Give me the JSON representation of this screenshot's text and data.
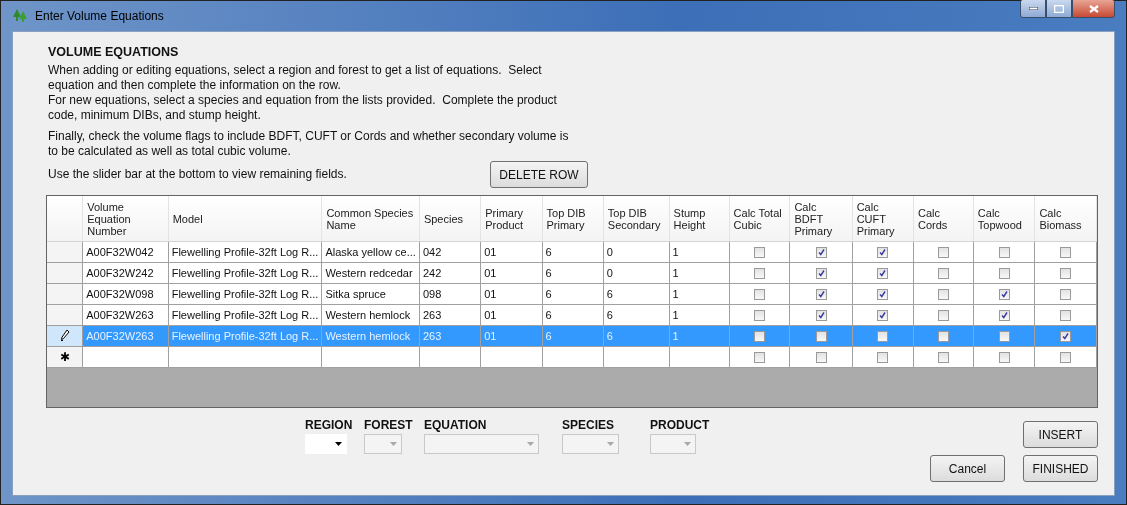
{
  "window": {
    "title": "Enter Volume Equations"
  },
  "intro": {
    "heading": "VOLUME EQUATIONS",
    "paragraphs": [
      "When adding or editing equations, select a region and forest to get a list of equations.  Select equation and then complete the information on the row.",
      "For new equations, select a species and equation from the lists provided.  Complete the product code, minimum DIBs, and stump height.",
      "Finally, check the volume flags to include BDFT, CUFT or Cords and whether secondary volume is to be calculated as well as total cubic volume.",
      "Use the slider bar at the bottom to view remaining fields."
    ],
    "delete_button": "DELETE ROW"
  },
  "table": {
    "columns": [
      "Volume Equation Number",
      "Model",
      "Common Species Name",
      "Species",
      "Primary Product",
      "Top DIB Primary",
      "Top DIB Secondary",
      "Stump Height",
      "Calc Total Cubic",
      "Calc BDFT Primary",
      "Calc CUFT Primary",
      "Calc Cords",
      "Calc Topwood",
      "Calc Biomass"
    ],
    "rows": [
      {
        "kind": "data",
        "selected": false,
        "cells": [
          "A00F32W042",
          "Flewelling Profile-32ft Log R...",
          "Alaska yellow ce...",
          "042",
          "01",
          "6",
          "0",
          "1"
        ],
        "checks": [
          false,
          true,
          true,
          false,
          false,
          false
        ]
      },
      {
        "kind": "data",
        "selected": false,
        "cells": [
          "A00F32W242",
          "Flewelling Profile-32ft Log R...",
          "Western redcedar",
          "242",
          "01",
          "6",
          "0",
          "1"
        ],
        "checks": [
          false,
          true,
          true,
          false,
          false,
          false
        ]
      },
      {
        "kind": "data",
        "selected": false,
        "cells": [
          "A00F32W098",
          "Flewelling Profile-32ft Log R...",
          "Sitka spruce",
          "098",
          "01",
          "6",
          "6",
          "1"
        ],
        "checks": [
          false,
          true,
          true,
          false,
          true,
          false
        ]
      },
      {
        "kind": "data",
        "selected": false,
        "cells": [
          "A00F32W263",
          "Flewelling Profile-32ft Log R...",
          "Western hemlock",
          "263",
          "01",
          "6",
          "6",
          "1"
        ],
        "checks": [
          false,
          true,
          true,
          false,
          true,
          false
        ]
      },
      {
        "kind": "data",
        "selected": true,
        "cells": [
          "A00F32W263",
          "Flewelling Profile-32ft Log R...",
          "Western hemlock",
          "263",
          "01",
          "6",
          "6",
          "1"
        ],
        "checks": [
          false,
          false,
          false,
          false,
          false,
          true
        ]
      },
      {
        "kind": "new",
        "selected": false,
        "marker": "✱",
        "checks": [
          false,
          false,
          false,
          false,
          false,
          false
        ]
      }
    ]
  },
  "selectors": [
    {
      "label": "REGION",
      "disabled": false
    },
    {
      "label": "FOREST",
      "disabled": true
    },
    {
      "label": "EQUATION",
      "disabled": true
    },
    {
      "label": "SPECIES",
      "disabled": true
    },
    {
      "label": "PRODUCT",
      "disabled": true
    }
  ],
  "buttons": {
    "insert": "INSERT",
    "cancel": "Cancel",
    "finished": "FINISHED"
  }
}
